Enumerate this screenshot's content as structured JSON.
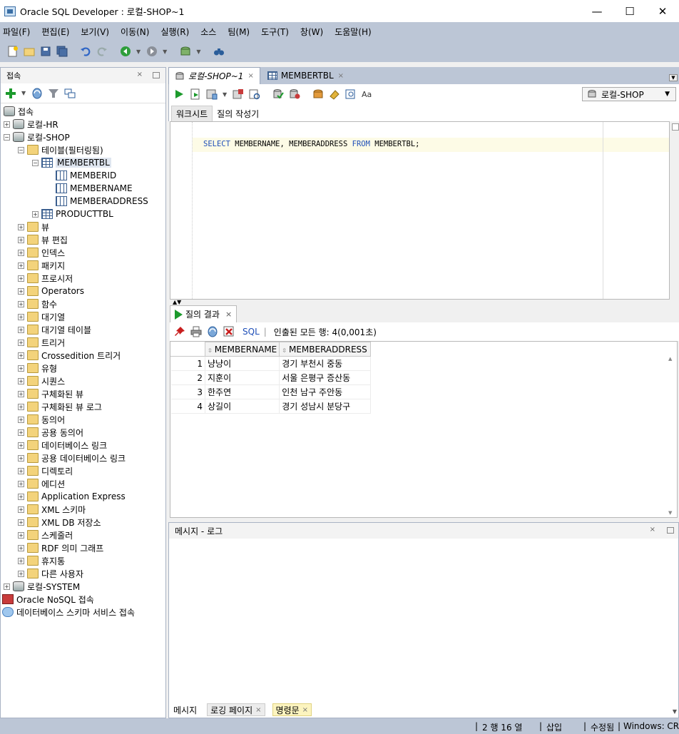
{
  "window": {
    "title": "Oracle SQL Developer : 로컬-SHOP~1",
    "minimize": "—",
    "maximize": "☐",
    "close": "✕"
  },
  "menu": [
    "파일(F)",
    "편집(E)",
    "보기(V)",
    "이동(N)",
    "실행(R)",
    "소스",
    "팀(M)",
    "도구(T)",
    "창(W)",
    "도움말(H)"
  ],
  "connections_panel": {
    "title": "접속",
    "close": "×",
    "root": "접속",
    "items": [
      {
        "label": "로컬-HR",
        "level": 1,
        "exp": "+",
        "icon": "db"
      },
      {
        "label": "로컬-SHOP",
        "level": 1,
        "exp": "−",
        "icon": "db"
      },
      {
        "label": "테이블(필터링됨)",
        "level": 2,
        "exp": "−",
        "icon": "folder"
      },
      {
        "label": "MEMBERTBL",
        "level": 3,
        "exp": "−",
        "icon": "table",
        "selected": true
      },
      {
        "label": "MEMBERID",
        "level": 4,
        "exp": "",
        "icon": "col"
      },
      {
        "label": "MEMBERNAME",
        "level": 4,
        "exp": "",
        "icon": "col"
      },
      {
        "label": "MEMBERADDRESS",
        "level": 4,
        "exp": "",
        "icon": "col"
      },
      {
        "label": "PRODUCTTBL",
        "level": 3,
        "exp": "+",
        "icon": "table"
      },
      {
        "label": "뷰",
        "level": 2,
        "exp": "+",
        "icon": "folder"
      },
      {
        "label": "뷰 편집",
        "level": 2,
        "exp": "+",
        "icon": "folder"
      },
      {
        "label": "인덱스",
        "level": 2,
        "exp": "+",
        "icon": "folder"
      },
      {
        "label": "패키지",
        "level": 2,
        "exp": "+",
        "icon": "folder"
      },
      {
        "label": "프로시저",
        "level": 2,
        "exp": "+",
        "icon": "folder"
      },
      {
        "label": "Operators",
        "level": 2,
        "exp": "+",
        "icon": "folder"
      },
      {
        "label": "함수",
        "level": 2,
        "exp": "+",
        "icon": "folder"
      },
      {
        "label": "대기열",
        "level": 2,
        "exp": "+",
        "icon": "folder"
      },
      {
        "label": "대기열 테이블",
        "level": 2,
        "exp": "+",
        "icon": "folder"
      },
      {
        "label": "트리거",
        "level": 2,
        "exp": "+",
        "icon": "folder"
      },
      {
        "label": "Crossedition 트리거",
        "level": 2,
        "exp": "+",
        "icon": "folder"
      },
      {
        "label": "유형",
        "level": 2,
        "exp": "+",
        "icon": "folder"
      },
      {
        "label": "시퀀스",
        "level": 2,
        "exp": "+",
        "icon": "folder"
      },
      {
        "label": "구체화된 뷰",
        "level": 2,
        "exp": "+",
        "icon": "folder"
      },
      {
        "label": "구체화된 뷰 로그",
        "level": 2,
        "exp": "+",
        "icon": "folder"
      },
      {
        "label": "동의어",
        "level": 2,
        "exp": "+",
        "icon": "folder"
      },
      {
        "label": "공용 동의어",
        "level": 2,
        "exp": "+",
        "icon": "folder"
      },
      {
        "label": "데이터베이스 링크",
        "level": 2,
        "exp": "+",
        "icon": "folder"
      },
      {
        "label": "공용 데이터베이스 링크",
        "level": 2,
        "exp": "+",
        "icon": "folder"
      },
      {
        "label": "디렉토리",
        "level": 2,
        "exp": "+",
        "icon": "folder"
      },
      {
        "label": "에디션",
        "level": 2,
        "exp": "+",
        "icon": "folder"
      },
      {
        "label": "Application Express",
        "level": 2,
        "exp": "+",
        "icon": "folder"
      },
      {
        "label": "XML 스키마",
        "level": 2,
        "exp": "+",
        "icon": "folder"
      },
      {
        "label": "XML DB 저장소",
        "level": 2,
        "exp": "+",
        "icon": "folder"
      },
      {
        "label": "스케줄러",
        "level": 2,
        "exp": "+",
        "icon": "folder"
      },
      {
        "label": "RDF 의미 그래프",
        "level": 2,
        "exp": "+",
        "icon": "folder"
      },
      {
        "label": "휴지통",
        "level": 2,
        "exp": "+",
        "icon": "folder"
      },
      {
        "label": "다른 사용자",
        "level": 2,
        "exp": "+",
        "icon": "folder"
      },
      {
        "label": "로컬-SYSTEM",
        "level": 1,
        "exp": "+",
        "icon": "db"
      },
      {
        "label": "Oracle NoSQL 접속",
        "level": 0,
        "exp": "",
        "icon": "nosql"
      },
      {
        "label": "데이터베이스 스키마 서비스 접속",
        "level": 0,
        "exp": "",
        "icon": "cloud"
      }
    ]
  },
  "editor": {
    "tabs": [
      {
        "label": "로컬-SHOP~1",
        "close": "×",
        "active": true
      },
      {
        "label": "MEMBERTBL",
        "close": "×",
        "active": false
      }
    ],
    "connection": "로컬-SHOP",
    "subtabs": [
      "워크시트",
      "질의 작성기"
    ],
    "code": {
      "select": "SELECT",
      "cols": " MEMBERNAME, MEMBERADDRESS ",
      "from": "FROM",
      "table": " MEMBERTBL;"
    }
  },
  "results": {
    "tab_label": "질의 결과",
    "tab_close": "×",
    "sql_label": "SQL",
    "fetch_status": "인출된 모든 행: 4(0,001초)",
    "columns": [
      "MEMBERNAME",
      "MEMBERADDRESS"
    ],
    "rows": [
      {
        "n": "1",
        "name": "냥냥이",
        "addr": "경기 부천시 중동"
      },
      {
        "n": "2",
        "name": "지훈이",
        "addr": "서울 은평구 증산동"
      },
      {
        "n": "3",
        "name": "한주연",
        "addr": "인천 남구 주안동"
      },
      {
        "n": "4",
        "name": "상길이",
        "addr": "경기 성남시 분당구"
      }
    ]
  },
  "messages": {
    "title": "메시지 - 로그",
    "close": "×",
    "tabs": [
      {
        "label": "메시지",
        "close": ""
      },
      {
        "label": "로깅 페이지",
        "close": "×"
      },
      {
        "label": "명령문",
        "close": "×"
      }
    ]
  },
  "status": {
    "position": "2 행 16 열",
    "mode": "삽입",
    "modified": "수정됨",
    "os": "Windows: CR"
  }
}
